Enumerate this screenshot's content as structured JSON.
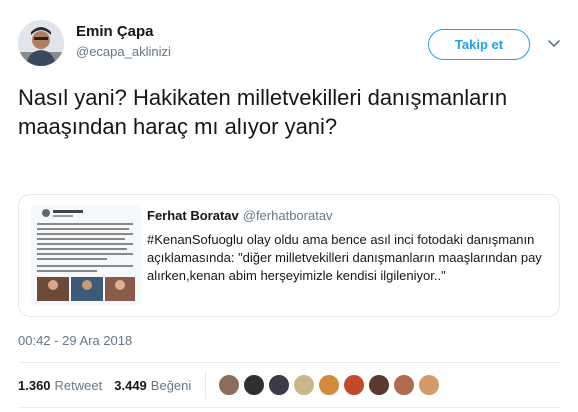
{
  "author": {
    "name": "Emin Çapa",
    "handle": "@ecapa_aklinizi",
    "avatar_icon": "user-avatar"
  },
  "follow_label": "Takip et",
  "tweet_text": "Nasıl yani? Hakikaten milletvekilleri danışmanların maaşından haraç mı alıyor yani?",
  "quoted": {
    "name": "Ferhat Boratav",
    "handle": "@ferhatboratav",
    "text": "#KenanSofuoglu olay oldu ama bence asıl inci fotodaki danışmanın açıklamasında: \"diğer milletvekilleri danışmanların maaşlarından pay alırken,kenan abim herşeyimizle kendisi ilgileniyor..\""
  },
  "timestamp": "00:42 - 29 Ara 2018",
  "stats": {
    "retweets_count": "1.360",
    "retweets_label": "Retweet",
    "likes_count": "3.449",
    "likes_label": "Beğeni"
  },
  "likers": [
    {
      "color": "#8a6d5a"
    },
    {
      "color": "#2f2f2f"
    },
    {
      "color": "#3b3b48"
    },
    {
      "color": "#c9b78a"
    },
    {
      "color": "#d28a3c"
    },
    {
      "color": "#c24a2b"
    },
    {
      "color": "#5a3a2e"
    },
    {
      "color": "#b06b4f"
    },
    {
      "color": "#d39a6a"
    }
  ],
  "colors": {
    "accent": "#1da1f2",
    "muted": "#657786",
    "border": "#e1e8ed"
  }
}
